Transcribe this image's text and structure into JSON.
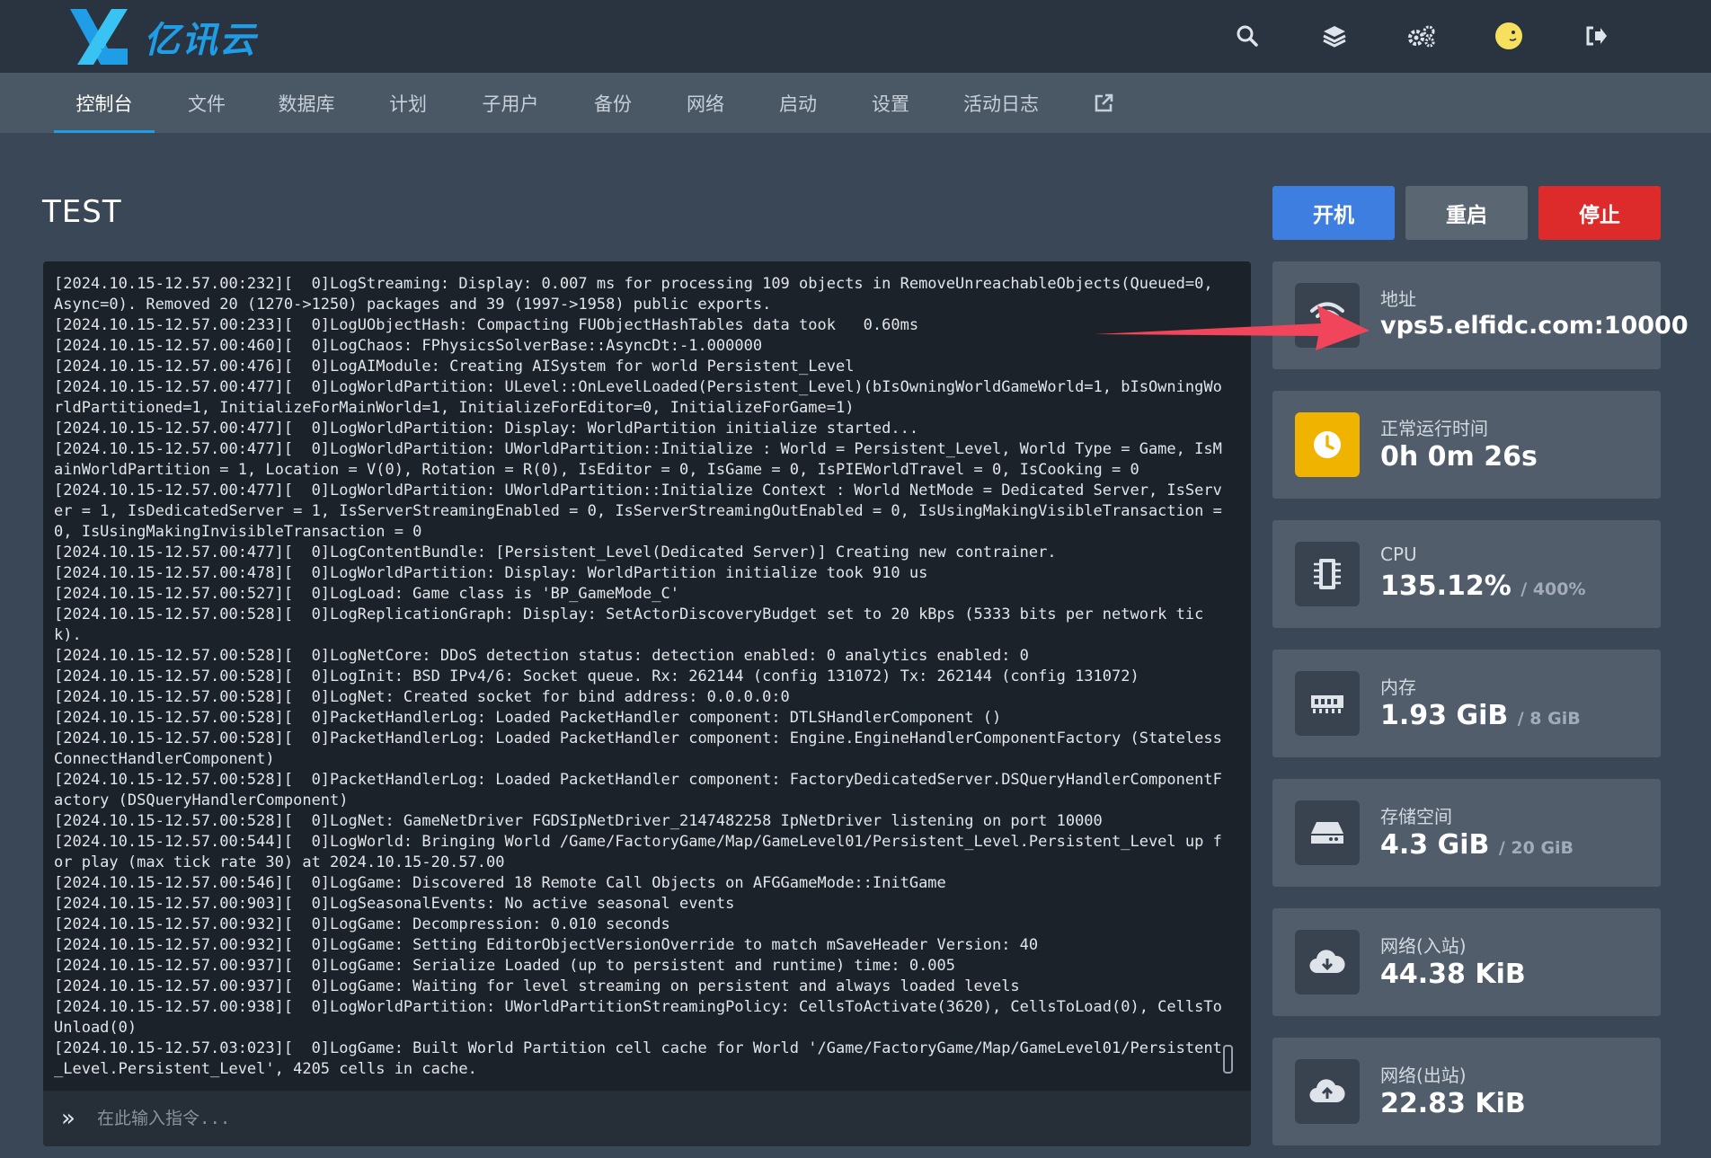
{
  "brand": {
    "name": "亿讯云"
  },
  "top_icons": [
    {
      "name": "search-icon"
    },
    {
      "name": "layers-icon"
    },
    {
      "name": "settings-gears-icon"
    },
    {
      "name": "avatar"
    },
    {
      "name": "logout-icon"
    }
  ],
  "nav": {
    "items": [
      {
        "label": "控制台",
        "active": true
      },
      {
        "label": "文件"
      },
      {
        "label": "数据库"
      },
      {
        "label": "计划"
      },
      {
        "label": "子用户"
      },
      {
        "label": "备份"
      },
      {
        "label": "网络"
      },
      {
        "label": "启动"
      },
      {
        "label": "设置"
      },
      {
        "label": "活动日志"
      }
    ],
    "external_icon": "external-link-icon"
  },
  "server": {
    "name": "TEST"
  },
  "power": {
    "start": "开机",
    "restart": "重启",
    "stop": "停止"
  },
  "console": {
    "log": "[2024.10.15-12.57.00:232][  0]LogStreaming: Display: 0.007 ms for processing 109 objects in RemoveUnreachableObjects(Queued=0, Async=0). Removed 20 (1270->1250) packages and 39 (1997->1958) public exports.\n[2024.10.15-12.57.00:233][  0]LogUObjectHash: Compacting FUObjectHashTables data took   0.60ms\n[2024.10.15-12.57.00:460][  0]LogChaos: FPhysicsSolverBase::AsyncDt:-1.000000\n[2024.10.15-12.57.00:476][  0]LogAIModule: Creating AISystem for world Persistent_Level\n[2024.10.15-12.57.00:477][  0]LogWorldPartition: ULevel::OnLevelLoaded(Persistent_Level)(bIsOwningWorldGameWorld=1, bIsOwningWorldPartitioned=1, InitializeForMainWorld=1, InitializeForEditor=0, InitializeForGame=1)\n[2024.10.15-12.57.00:477][  0]LogWorldPartition: Display: WorldPartition initialize started...\n[2024.10.15-12.57.00:477][  0]LogWorldPartition: UWorldPartition::Initialize : World = Persistent_Level, World Type = Game, IsMainWorldPartition = 1, Location = V(0), Rotation = R(0), IsEditor = 0, IsGame = 0, IsPIEWorldTravel = 0, IsCooking = 0\n[2024.10.15-12.57.00:477][  0]LogWorldPartition: UWorldPartition::Initialize Context : World NetMode = Dedicated Server, IsServer = 1, IsDedicatedServer = 1, IsServerStreamingEnabled = 0, IsServerStreamingOutEnabled = 0, IsUsingMakingVisibleTransaction = 0, IsUsingMakingInvisibleTransaction = 0\n[2024.10.15-12.57.00:477][  0]LogContentBundle: [Persistent_Level(Dedicated Server)] Creating new contrainer.\n[2024.10.15-12.57.00:478][  0]LogWorldPartition: Display: WorldPartition initialize took 910 us\n[2024.10.15-12.57.00:527][  0]LogLoad: Game class is 'BP_GameMode_C'\n[2024.10.15-12.57.00:528][  0]LogReplicationGraph: Display: SetActorDiscoveryBudget set to 20 kBps (5333 bits per network tick).\n[2024.10.15-12.57.00:528][  0]LogNetCore: DDoS detection status: detection enabled: 0 analytics enabled: 0\n[2024.10.15-12.57.00:528][  0]LogInit: BSD IPv4/6: Socket queue. Rx: 262144 (config 131072) Tx: 262144 (config 131072)\n[2024.10.15-12.57.00:528][  0]LogNet: Created socket for bind address: 0.0.0.0:0\n[2024.10.15-12.57.00:528][  0]PacketHandlerLog: Loaded PacketHandler component: DTLSHandlerComponent ()\n[2024.10.15-12.57.00:528][  0]PacketHandlerLog: Loaded PacketHandler component: Engine.EngineHandlerComponentFactory (StatelessConnectHandlerComponent)\n[2024.10.15-12.57.00:528][  0]PacketHandlerLog: Loaded PacketHandler component: FactoryDedicatedServer.DSQueryHandlerComponentFactory (DSQueryHandlerComponent)\n[2024.10.15-12.57.00:528][  0]LogNet: GameNetDriver FGDSIpNetDriver_2147482258 IpNetDriver listening on port 10000\n[2024.10.15-12.57.00:544][  0]LogWorld: Bringing World /Game/FactoryGame/Map/GameLevel01/Persistent_Level.Persistent_Level up for play (max tick rate 30) at 2024.10.15-20.57.00\n[2024.10.15-12.57.00:546][  0]LogGame: Discovered 18 Remote Call Objects on AFGGameMode::InitGame\n[2024.10.15-12.57.00:903][  0]LogSeasonalEvents: No active seasonal events\n[2024.10.15-12.57.00:932][  0]LogGame: Decompression: 0.010 seconds\n[2024.10.15-12.57.00:932][  0]LogGame: Setting EditorObjectVersionOverride to match mSaveHeader Version: 40\n[2024.10.15-12.57.00:937][  0]LogGame: Serialize Loaded (up to persistent and runtime) time: 0.005\n[2024.10.15-12.57.00:937][  0]LogGame: Waiting for level streaming on persistent and always loaded levels\n[2024.10.15-12.57.00:938][  0]LogWorldPartition: UWorldPartitionStreamingPolicy: CellsToActivate(3620), CellsToLoad(0), CellsToUnload(0)\n[2024.10.15-12.57.03:023][  0]LogGame: Built World Partition cell cache for World '/Game/FactoryGame/Map/GameLevel01/Persistent_Level.Persistent_Level', 4205 cells in cache.",
    "input_placeholder": "在此输入指令...",
    "prompt_glyph": "»"
  },
  "stats": {
    "address": {
      "label": "地址",
      "value": "vps5.elfidc.com:10000",
      "icon": "wifi-icon"
    },
    "uptime": {
      "label": "正常运行时间",
      "value": "0h 0m 26s",
      "icon": "clock-icon"
    },
    "cpu": {
      "label": "CPU",
      "value": "135.12%",
      "limit": "/ 400%",
      "icon": "cpu-chip-icon"
    },
    "memory": {
      "label": "内存",
      "value": "1.93 GiB",
      "limit": "/ 8 GiB",
      "icon": "memory-icon"
    },
    "storage": {
      "label": "存储空间",
      "value": "4.3 GiB",
      "limit": "/ 20 GiB",
      "icon": "hard-drive-icon"
    },
    "net_in": {
      "label": "网络(入站)",
      "value": "44.38 KiB",
      "icon": "cloud-download-icon"
    },
    "net_out": {
      "label": "网络(出站)",
      "value": "22.83 KiB",
      "icon": "cloud-upload-icon"
    }
  },
  "colors": {
    "accent": "#1f9de6",
    "start": "#3d7ee0",
    "restart": "#5b6673",
    "stop": "#dd2b2b",
    "warning": "#f0b400",
    "annotation_arrow": "#f0455a"
  }
}
